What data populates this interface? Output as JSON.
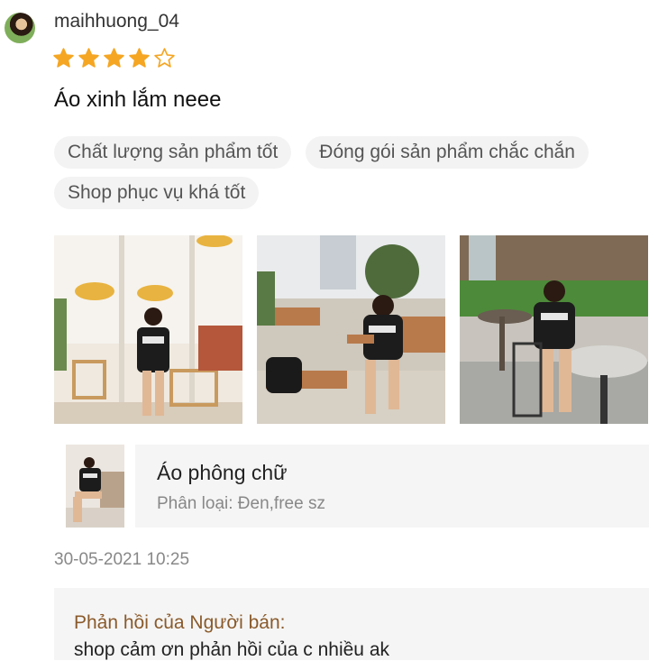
{
  "review": {
    "username": "maihhuong_04",
    "rating": 4,
    "rating_max": 5,
    "comment": "Áo xinh lắm neee",
    "tags": [
      "Chất lượng sản phẩm tốt",
      "Đóng gói sản phẩm chắc chắn",
      "Shop phục vụ khá tốt"
    ],
    "photo_count": 3,
    "timestamp": "30-05-2021 10:25"
  },
  "product": {
    "name": "Áo phông chữ",
    "variant": "Phân loại: Đen,free sz"
  },
  "seller_reply": {
    "title": "Phản hồi của Người bán:",
    "text": "shop cảm ơn phản hồi của c nhiều ak"
  },
  "colors": {
    "star": "#f5a623",
    "tag_bg": "#f3f3f3",
    "reply_title": "#8a5a2b",
    "panel_bg": "#f5f5f5"
  },
  "icons": {
    "star_filled": "star-icon",
    "star_empty": "star-outline-icon"
  }
}
